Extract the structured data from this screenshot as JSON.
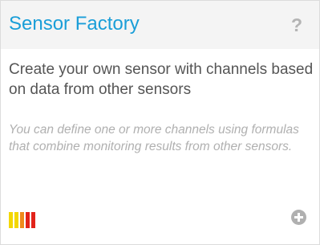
{
  "card": {
    "title": "Sensor Factory",
    "help_label": "?",
    "description": "Create your own sensor with channels based on data from other sensors",
    "note": "You can define one or more channels using formulas that combine monitoring results from other sensors.",
    "performance_bars": {
      "icon": "performance-bars-icon",
      "colors": [
        "#f3d700",
        "#f3d700",
        "#ef8a1c",
        "#e2231a",
        "#e2231a"
      ]
    },
    "add_icon": "plus-circle-icon"
  }
}
